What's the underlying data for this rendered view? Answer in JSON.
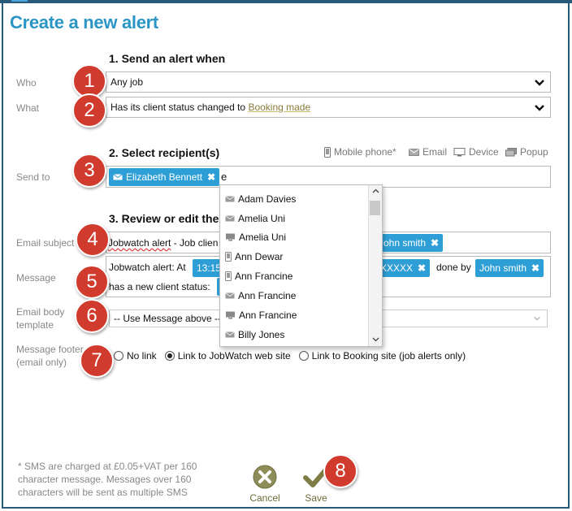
{
  "title": "Create a new alert",
  "section1": {
    "num": "1.",
    "heading": "Send an alert when"
  },
  "who": {
    "label": "Who",
    "value": "Any job"
  },
  "what": {
    "label": "What",
    "value_prefix": "Has its client status changed to ",
    "value_link": "Booking made"
  },
  "section2": {
    "num": "2.",
    "heading": "Select recipient(s)"
  },
  "recipient_options": {
    "mobile": "Mobile phone*",
    "email": "Email",
    "device": "Device",
    "popup": "Popup"
  },
  "send_to": {
    "label": "Send to",
    "chip": "Elizabeth Bennett",
    "typed": "e"
  },
  "dropdown": {
    "items": [
      {
        "name": "Adam Davies",
        "icon": "email-icon"
      },
      {
        "name": "Amelia Uni",
        "icon": "email-icon"
      },
      {
        "name": "Amelia Uni",
        "icon": "device-icon"
      },
      {
        "name": "Ann Dewar",
        "icon": "mobile-phone-icon"
      },
      {
        "name": "Ann Francine",
        "icon": "mobile-phone-icon"
      },
      {
        "name": "Ann Francine",
        "icon": "email-icon"
      },
      {
        "name": "Ann Francine",
        "icon": "device-icon"
      },
      {
        "name": "Billy Jones",
        "icon": "email-icon"
      }
    ]
  },
  "section3": {
    "num": "3.",
    "heading": "Review or edit the"
  },
  "email_subject": {
    "label": "Email subject",
    "prefix": "Jobwatch alert",
    "rest": " - Job clien",
    "chip": "John smith"
  },
  "message": {
    "label": "Message",
    "line1_prefix": "Jobwatch alert: At",
    "time_chip": "13:15",
    "ref_chip": "e XXXXX",
    "done_by": "done by",
    "person_chip": "John smith",
    "line2": "has a new client status:"
  },
  "email_body_template": {
    "label_line1": "Email body",
    "label_line2": "template",
    "value": "-- Use Message above --"
  },
  "message_footer": {
    "label_line1": "Message footer",
    "label_line2": "(email only)",
    "options": [
      "No link",
      "Link to JobWatch web site",
      "Link to Booking site (job alerts only)"
    ],
    "selected": 1
  },
  "sms_note": {
    "line1": "* SMS are charged at £0.05+VAT per 160",
    "line2": "character message. Messages over 160",
    "line3": "characters will be sent as multiple SMS"
  },
  "buttons": {
    "cancel": "Cancel",
    "save": "Save"
  },
  "badges": [
    "1",
    "2",
    "3",
    "4",
    "5",
    "6",
    "7",
    "8"
  ],
  "colors": {
    "title": "#2b95c5",
    "chip": "#2e9fd6",
    "badge": "#d13b2e",
    "frame": "#2a5a7a"
  }
}
